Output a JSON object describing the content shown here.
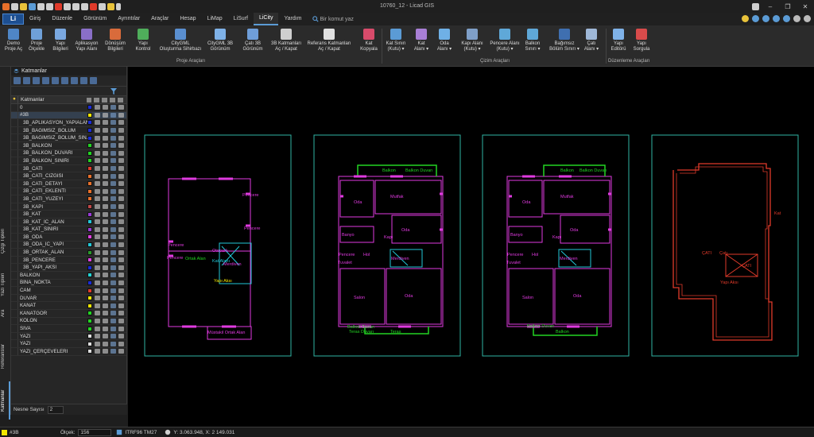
{
  "window": {
    "title": "10760_12 - Licad GIS"
  },
  "menubar": {
    "app_button": "Li",
    "items": [
      "Giriş",
      "Düzenle",
      "Görünüm",
      "Ayrıntılar",
      "Araçlar",
      "Hesap",
      "LiMap",
      "LiSurf",
      "LiCity",
      "Yardım"
    ],
    "active_item": "LiCity",
    "search_placeholder": "Bir komut yaz"
  },
  "ribbon": {
    "buttons": [
      {
        "label": "Demo\nProje Aç",
        "color": "#4f86c6"
      },
      {
        "label": "Proje\nÖlçekle",
        "color": "#6fa0d8"
      },
      {
        "label": "Yapı\nBilgileri",
        "color": "#7aa8e0"
      },
      {
        "label": "Aplikasyon\nYapı Alanı",
        "color": "#8a6fc8"
      },
      {
        "label": "Dönüşüm\nBilgileri",
        "color": "#d96b3b"
      },
      {
        "label": "Yapı\nKontrol",
        "color": "#4fae5b"
      },
      {
        "label": "CityGML\nOluşturma Sihirbazı",
        "color": "#5a8fd0"
      },
      {
        "label": "CityGML 3B\nGörünüm",
        "color": "#7fb2e8"
      },
      {
        "label": "Çatı 3B\nGörünüm",
        "color": "#6f9ed9"
      },
      {
        "label": "3B Katmanları\nAç / Kapat",
        "color": "#cfcfcf"
      },
      {
        "label": "Referans Katmanları\nAç / Kapat",
        "color": "#e0e0e0"
      },
      {
        "label": "Kat\nKopyala",
        "color": "#d84b6b"
      },
      {
        "label": "Kat Sınırı\n(Kutu) ▾",
        "color": "#5b9bd5"
      },
      {
        "label": "Kat\nAlanı ▾",
        "color": "#a97fd6"
      },
      {
        "label": "Oda\nAlanı ▾",
        "color": "#6fb0e6"
      },
      {
        "label": "Kapı Alanı\n(Kutu) ▾",
        "color": "#7f9fc8"
      },
      {
        "label": "Pencere Alanı\n(Kutu) ▾",
        "color": "#5fa8d8"
      },
      {
        "label": "Balkon\nSınırı ▾",
        "color": "#5fa8d8"
      },
      {
        "label": "Bağımsız\nBölüm Sınırı ▾",
        "color": "#3f6fb0"
      },
      {
        "label": "Çatı\nAlanı ▾",
        "color": "#9fb8d8"
      },
      {
        "label": "Yapı\nEditörü",
        "color": "#7fb2e8"
      },
      {
        "label": "Yapı\nSorgula",
        "color": "#d84b4b"
      }
    ],
    "groups": [
      "Proje Araçları",
      "Çizim Araçları",
      "Düzenleme Araçları"
    ]
  },
  "left_tabs": [
    "Katmanlar",
    "Referanslar",
    "Ara",
    "Yazı Tipleri",
    "Çizgi Tipleri"
  ],
  "layers_panel": {
    "title": "Katmanlar",
    "column_header": "Katmanlar",
    "layers": [
      {
        "name": "0",
        "color": "#1a2bd8",
        "indent": false
      },
      {
        "name": "#3B",
        "color": "#f2e600",
        "indent": false
      },
      {
        "name": "3B_APLIKASYON_YAPIALANI",
        "color": "#1a2bd8",
        "indent": true
      },
      {
        "name": "3B_BAGIMSIZ_BOLUM",
        "color": "#1a2bd8",
        "indent": true
      },
      {
        "name": "3B_BAGIMSIZ_BOLUM_SIN...",
        "color": "#1a2bd8",
        "indent": true
      },
      {
        "name": "3B_BALKON",
        "color": "#22d422",
        "indent": true
      },
      {
        "name": "3B_BALKON_DUVARI",
        "color": "#22d422",
        "indent": true
      },
      {
        "name": "3B_BALKON_SINIRI",
        "color": "#22d422",
        "indent": true
      },
      {
        "name": "3B_CATI",
        "color": "#e03a2a",
        "indent": true
      },
      {
        "name": "3B_CATI_CIZGISI",
        "color": "#e8702a",
        "indent": true
      },
      {
        "name": "3B_CATI_DETAYI",
        "color": "#e8702a",
        "indent": true
      },
      {
        "name": "3B_CATI_EKLENTI",
        "color": "#e8702a",
        "indent": true
      },
      {
        "name": "3B_CATI_YUZEYI",
        "color": "#e8702a",
        "indent": true
      },
      {
        "name": "3B_KAPI",
        "color": "#c04848",
        "indent": true
      },
      {
        "name": "3B_KAT",
        "color": "#9a3ad8",
        "indent": true
      },
      {
        "name": "3B_KAT_IC_ALAN",
        "color": "#22c8d8",
        "indent": true
      },
      {
        "name": "3B_KAT_SINIRI",
        "color": "#9a3ad8",
        "indent": true
      },
      {
        "name": "3B_ODA",
        "color": "#e040e0",
        "indent": true
      },
      {
        "name": "3B_ODA_IC_YAPI",
        "color": "#22c8d8",
        "indent": true
      },
      {
        "name": "3B_ORTAK_ALAN",
        "color": "#2a9a2a",
        "indent": true
      },
      {
        "name": "3B_PENCERE",
        "color": "#e040e0",
        "indent": true
      },
      {
        "name": "3B_YAPI_AKSI",
        "color": "#1a2bd8",
        "indent": true
      },
      {
        "name": "BALKON",
        "color": "#22d4d4",
        "indent": false
      },
      {
        "name": "BINA_NOKTA",
        "color": "#1a2bd8",
        "indent": false
      },
      {
        "name": "CAM",
        "color": "#e03a2a",
        "indent": false
      },
      {
        "name": "DUVAR",
        "color": "#f2e600",
        "indent": false
      },
      {
        "name": "KANAT",
        "color": "#f2e600",
        "indent": false
      },
      {
        "name": "KANATGOR",
        "color": "#22d422",
        "indent": false
      },
      {
        "name": "KOLON",
        "color": "#22d422",
        "indent": false
      },
      {
        "name": "SIVA",
        "color": "#22d422",
        "indent": false
      },
      {
        "name": "YAZI",
        "color": "#dddddd",
        "indent": false
      },
      {
        "name": "YAZI",
        "color": "#dddddd",
        "indent": false
      },
      {
        "name": "YAZI_ÇERÇEVELERI",
        "color": "#dddddd",
        "indent": false
      }
    ],
    "footer_label": "Nesne Sayısı",
    "footer_value": "2"
  },
  "drawing": {
    "colors": {
      "frame": "#2fb5a4",
      "magenta": "#e03ae0",
      "green": "#22d422",
      "cyan": "#22c8d8",
      "red": "#e03a2a",
      "yellow": "#f2e600"
    },
    "sheet1": {
      "labels": [
        "Otopark",
        "Ortak Alan",
        "Merdiven",
        "Yapı Aksı",
        "Pencere",
        "Pencere",
        "Pencere",
        "Pencere",
        "Müstakil Ortak Alan",
        "Kat Alanı"
      ]
    },
    "sheet2": {
      "labels": [
        "Balkon",
        "Balkon Duvarı",
        "Mutfak",
        "Oda",
        "Oda",
        "Oda",
        "Banyo",
        "Hol",
        "Salon",
        "Tuvalet",
        "Merdiven",
        "Kapı",
        "Pencere",
        "Teras Duvarı",
        "Teras",
        "Balkon Duvarı"
      ]
    },
    "sheet3": {
      "labels": [
        "Balkon",
        "Balkon Duvarı",
        "Mutfak",
        "Oda",
        "Oda",
        "Oda",
        "Banyo",
        "Hol",
        "Salon",
        "Tuvalet",
        "Merdiven",
        "Kapı",
        "Pencere",
        "Balkon Duvarı",
        "Balkon"
      ]
    },
    "sheet4": {
      "labels": [
        "ÇATI",
        "Çatı",
        "ÇATI",
        "Yapı Aksı",
        "Kat"
      ]
    }
  },
  "statusbar": {
    "layer": "#3B",
    "scale_label": "Ölçek:",
    "scale_value": "156",
    "crs": "ITRF96 TM27",
    "coords": "Y: 3.063.948, X: 2 149.031"
  }
}
